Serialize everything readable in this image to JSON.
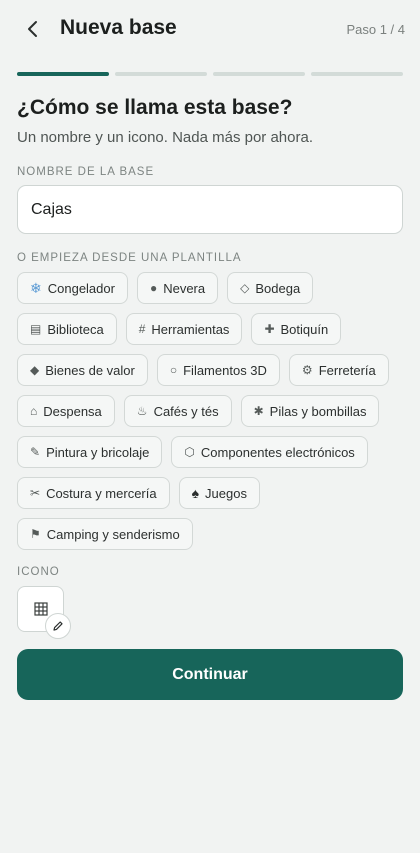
{
  "header": {
    "title": "Nueva base",
    "step": "Paso 1 / 4"
  },
  "progress": {
    "total_steps": 4,
    "current_step": 1
  },
  "main": {
    "heading": "¿Cómo se llama esta base?",
    "subheading": "Un nombre y un icono. Nada más por ahora.",
    "name_label": "NOMBRE DE LA BASE",
    "name_value": "Cajas",
    "templates_label": "O EMPIEZA DESDE UNA PLANTILLA",
    "templates": [
      {
        "icon": "❄",
        "icon_name": "snowflake-icon",
        "label": "Congelador"
      },
      {
        "icon": "●",
        "icon_name": "dot-icon",
        "label": "Nevera"
      },
      {
        "icon": "◇",
        "icon_name": "diamond-outline-icon",
        "label": "Bodega"
      },
      {
        "icon": "▤",
        "icon_name": "book-icon",
        "label": "Biblioteca"
      },
      {
        "icon": "#",
        "icon_name": "hash-icon",
        "label": "Herramientas"
      },
      {
        "icon": "✚",
        "icon_name": "cross-icon",
        "label": "Botiquín"
      },
      {
        "icon": "◆",
        "icon_name": "diamond-icon",
        "label": "Bienes de valor"
      },
      {
        "icon": "○",
        "icon_name": "circle-icon",
        "label": "Filamentos 3D"
      },
      {
        "icon": "⚙",
        "icon_name": "gear-icon",
        "label": "Ferretería"
      },
      {
        "icon": "⌂",
        "icon_name": "house-icon",
        "label": "Despensa"
      },
      {
        "icon": "♨",
        "icon_name": "hot-cup-icon",
        "label": "Cafés y tés"
      },
      {
        "icon": "✱",
        "icon_name": "asterisk-icon",
        "label": "Pilas y bombillas"
      },
      {
        "icon": "✎",
        "icon_name": "pencil-icon",
        "label": "Pintura y bricolaje"
      },
      {
        "icon": "⬡",
        "icon_name": "hexagon-icon",
        "label": "Componentes electrónicos"
      },
      {
        "icon": "✂",
        "icon_name": "scissors-icon",
        "label": "Costura y mercería"
      },
      {
        "icon": "♠",
        "icon_name": "spade-icon",
        "label": "Juegos"
      },
      {
        "icon": "⚑",
        "icon_name": "flag-icon",
        "label": "Camping y senderismo"
      }
    ],
    "icon_label": "ICONO",
    "selected_icon": "grid-icon",
    "continue_label": "Continuar"
  },
  "colors": {
    "accent": "#17655a",
    "background": "#f1f3f2",
    "progress_inactive": "#d3dbd8"
  }
}
